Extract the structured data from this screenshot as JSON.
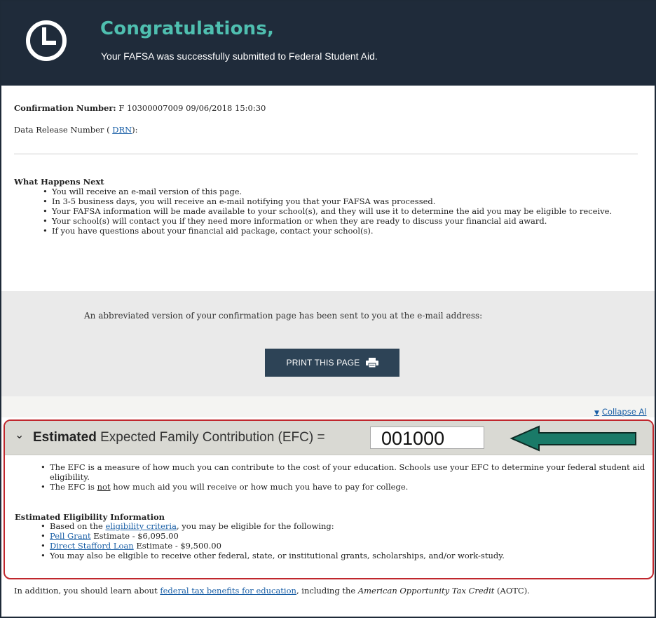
{
  "header": {
    "title": "Congratulations,",
    "subtitle": "Your FAFSA was successfully submitted to Federal Student Aid.",
    "icon": "clock-icon"
  },
  "confirmation": {
    "label": "Confirmation Number:",
    "value": "F 10300007009 09/06/2018 15:0:30"
  },
  "drn": {
    "prefix": "Data Release Number (",
    "link": "DRN",
    "suffix": "):"
  },
  "what_happens": {
    "title": "What Happens Next",
    "items": [
      "You will receive an e-mail version of this page.",
      "In 3-5 business days, you will receive an e-mail notifying you that your FAFSA was processed.",
      "Your FAFSA information will be made available to your school(s), and they will use it to determine the aid you may be eligible to receive.",
      "Your school(s) will contact you if they need more information or when they are ready to discuss your financial aid award.",
      "If you have questions about your financial aid package, contact your school(s)."
    ]
  },
  "email_note": "An abbreviated version of your confirmation page has been sent to you at the e-mail address:",
  "print_button": {
    "label": "PRINT THIS PAGE",
    "icon": "printer-icon"
  },
  "collapse_all": "Collapse Al",
  "efc": {
    "label_bold": "Estimated",
    "label_rest": " Expected Family Contribution (EFC) =",
    "value": "001000",
    "annotation_color": "#c0272d",
    "arrow_color": "#1a7a68",
    "items": [
      "The EFC is a measure of how much you can contribute to the cost of your education. Schools use your EFC to determine your federal student aid eligibility.",
      {
        "pre": "The EFC is ",
        "underline": "not",
        "post": " how much aid you will receive or how much you have to pay for college."
      }
    ]
  },
  "eligibility": {
    "title": "Estimated Eligibility Information",
    "criteria_pre": "Based on the ",
    "criteria_link": "eligibility criteria",
    "criteria_post": ", you may be eligible for the following:",
    "pell_link": "Pell Grant",
    "pell_text": " Estimate - $6,095.00",
    "stafford_link": "Direct Stafford Loan",
    "stafford_text": " Estimate - $9,500.00",
    "other": "You may also be eligible to receive other federal, state, or institutional grants, scholarships, and/or work-study."
  },
  "additional": {
    "pre": "In addition, you should learn about ",
    "link": "federal tax benefits for education",
    "mid": ", including the ",
    "italic": "American Opportunity Tax Credit",
    "post": " (AOTC)."
  },
  "colors": {
    "header_bg": "#1f2b3a",
    "title": "#4fbfb0",
    "link": "#1a5fa6",
    "button": "#2d4356"
  }
}
